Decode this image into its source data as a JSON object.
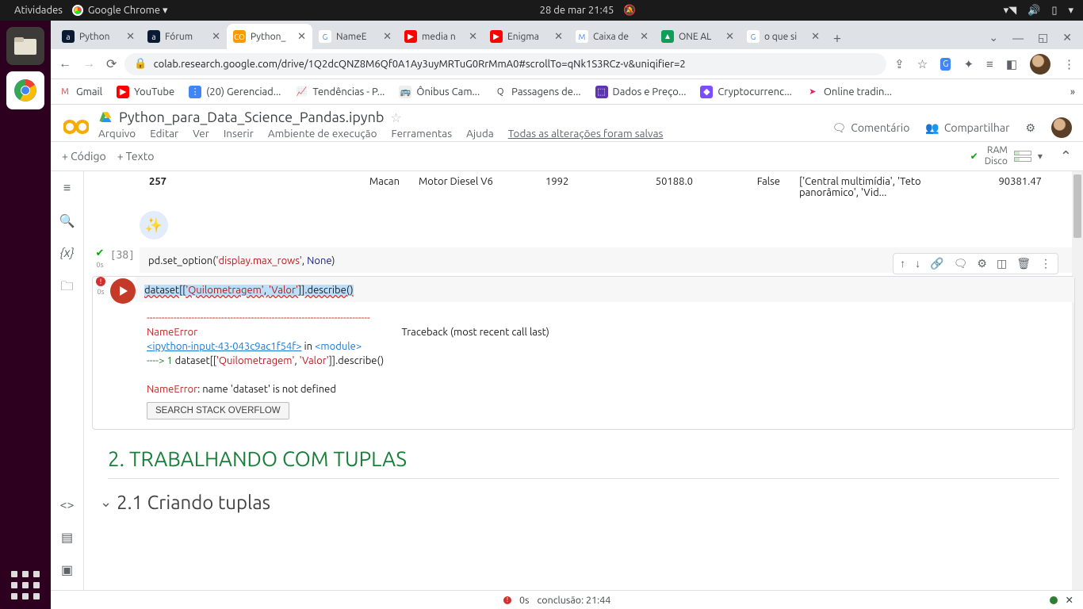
{
  "os_panel": {
    "activities": "Atividades",
    "app": "Google Chrome ▾",
    "clock": "28 de mar  21:45"
  },
  "tabs": [
    {
      "title": "Python",
      "fav_bg": "#0b1a33",
      "fav_txt": "a",
      "active": false
    },
    {
      "title": "Fórum",
      "fav_bg": "#0b1a33",
      "fav_txt": "a",
      "active": false
    },
    {
      "title": "Python_",
      "fav_bg": "#f90",
      "fav_txt": "CO",
      "active": true
    },
    {
      "title": "NameE",
      "fav_bg": "#fff",
      "fav_txt": "G",
      "active": false
    },
    {
      "title": "media n",
      "fav_bg": "#f00",
      "fav_txt": "▶",
      "active": false
    },
    {
      "title": "Enigma",
      "fav_bg": "#f00",
      "fav_txt": "▶",
      "active": false
    },
    {
      "title": "Caixa de",
      "fav_bg": "#fff",
      "fav_txt": "M",
      "active": false
    },
    {
      "title": "ONE AL",
      "fav_bg": "#0f9d58",
      "fav_txt": "▲",
      "active": false
    },
    {
      "title": "o que si",
      "fav_bg": "#fff",
      "fav_txt": "G",
      "active": false
    }
  ],
  "url": "colab.research.google.com/drive/1Q2dcQNZ8M6Qf0A1Ay3uyMRTuG0RrMmA0#scrollTo=qNk1S3RCz-v&uniqifier=2",
  "bookmarks": [
    {
      "label": "Gmail",
      "bg": "#fff",
      "txt": "M",
      "fg": "#d44"
    },
    {
      "label": "YouTube",
      "bg": "#f00",
      "txt": "▶",
      "fg": "#fff"
    },
    {
      "label": "(20) Gerenciad...",
      "bg": "#4285f4",
      "txt": "⋮",
      "fg": "#fff"
    },
    {
      "label": "Tendências - P...",
      "bg": "#fff",
      "txt": "📈",
      "fg": "#4285f4"
    },
    {
      "label": "Ônibus Cam...",
      "bg": "#eee",
      "txt": "🚌",
      "fg": "#333"
    },
    {
      "label": "Passagens de...",
      "bg": "#fff",
      "txt": "Q",
      "fg": "#333"
    },
    {
      "label": "Dados e Preço...",
      "bg": "#5e35b1",
      "txt": "⬚",
      "fg": "#fff"
    },
    {
      "label": "Cryptocurrenc...",
      "bg": "#7c4dff",
      "txt": "◆",
      "fg": "#fff"
    },
    {
      "label": "Online tradin...",
      "bg": "#fff",
      "txt": "➤",
      "fg": "#e91e63"
    }
  ],
  "doc": {
    "title": "Python_para_Data_Science_Pandas.ipynb",
    "menus": [
      "Arquivo",
      "Editar",
      "Ver",
      "Inserir",
      "Ambiente de execução",
      "Ferramentas",
      "Ajuda"
    ],
    "save_status": "Todas as alterações foram salvas",
    "actions": {
      "comment": "Comentário",
      "share": "Compartilhar"
    }
  },
  "toolbar": {
    "code": "+  Código",
    "text": "+  Texto",
    "ram": "RAM",
    "disk": "Disco"
  },
  "table_row": {
    "idx": "257",
    "c1": "Macan",
    "c2": "Motor Diesel V6",
    "c3": "1992",
    "c4": "50188.0",
    "c5": "False",
    "c6": "['Central multimídia', 'Teto panorâmico', 'Vid...",
    "c7": "90381.47"
  },
  "cell38": {
    "exec_count": "[38]",
    "time": "0s",
    "code_pre": "pd.set_option(",
    "code_str": "'display.max_rows'",
    "code_mid": ", ",
    "code_kw": "None",
    "code_post": ")"
  },
  "cell_err": {
    "time": "0s",
    "code_pre": "dataset[[",
    "code_str1": "'Quilometragem'",
    "code_mid": ", ",
    "code_str2": "'Valor'",
    "code_post": "]].describe()",
    "dashes": "---------------------------------------------------------------------------",
    "err_name": "NameError",
    "traceback_label": "Traceback (most recent call last)",
    "ipy_link": "<ipython-input-43-043c9ac1f54f>",
    "in_txt": " in ",
    "module": "<module>",
    "arrow": "----> 1 ",
    "line_pre": "dataset[[",
    "line_s1": "'Quilometragem'",
    "line_mid": ", ",
    "line_s2": "'Valor'",
    "line_post": "]].describe()",
    "err_msg_name": "NameError",
    "err_msg": ": name 'dataset' is not defined",
    "so_btn": "SEARCH STACK OVERFLOW"
  },
  "headings": {
    "h2": "2. TRABALHANDO COM TUPLAS",
    "h3": "2.1 Criando tuplas"
  },
  "status": {
    "time": "0s",
    "done": "conclusão: 21:44",
    "close": "✕"
  }
}
